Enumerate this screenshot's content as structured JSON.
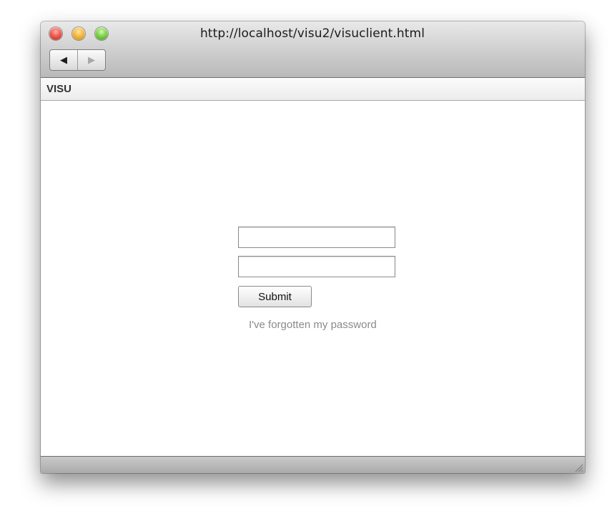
{
  "window": {
    "url_title": "http://localhost/visu2/visuclient.html",
    "traffic_lights": [
      "close-icon",
      "minimize-icon",
      "zoom-icon"
    ],
    "nav": {
      "back_icon": "◀",
      "forward_icon": "▶"
    }
  },
  "app": {
    "title": "VISU"
  },
  "login": {
    "username_value": "",
    "password_value": "",
    "submit_label": "Submit",
    "forgot_link": "I've forgotten my password"
  },
  "colors": {
    "link": "#8a8a8a",
    "close": "#ee5a50",
    "minimize": "#f6b73f",
    "zoom": "#7fd24b"
  }
}
